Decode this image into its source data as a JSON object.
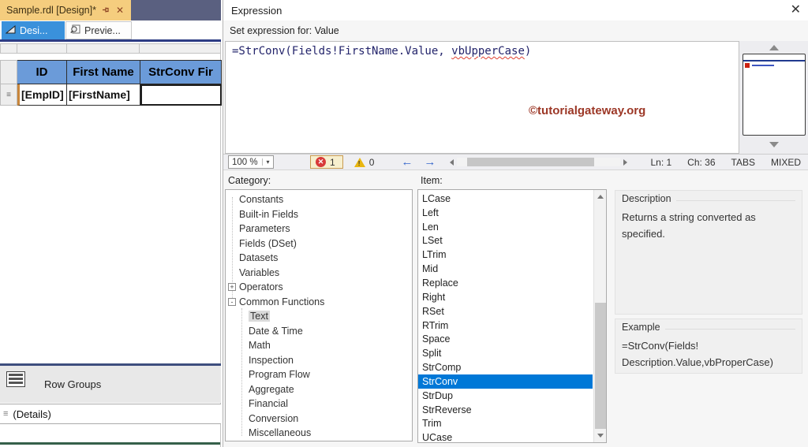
{
  "window": {
    "doc_tab_title": "Sample.rdl [Design]*",
    "close_glyph": "✕",
    "design_tab": "Desi...",
    "preview_tab": "Previe..."
  },
  "designer": {
    "table": {
      "headers": [
        "ID",
        "First Name",
        "StrConv Fir"
      ],
      "cells": [
        "[EmpID]",
        "[FirstName]",
        ""
      ],
      "row_handle_glyph": "≡"
    },
    "grouping": {
      "row_groups_label": "Row Groups",
      "details_row": "(Details)",
      "details_glyph": "≡"
    }
  },
  "dialog": {
    "title": "Expression",
    "close_glyph": "✕",
    "set_expression_label": "Set expression for: Value",
    "expression": {
      "prefix": "=StrConv(Fields!FirstName.Value, ",
      "error_token": "vbUpperCase",
      "suffix": ")"
    },
    "watermark": "©tutorialgateway.org",
    "toolbar": {
      "zoom": "100 %",
      "zoom_arrow": "▾",
      "error_count": "1",
      "warning_count": "0",
      "back_arrow": "←",
      "forward_arrow": "→",
      "ln": "Ln: 1",
      "ch": "Ch: 36",
      "tabs": "TABS",
      "mixed": "MIXED"
    },
    "category": {
      "label": "Category:",
      "items": [
        {
          "label": "Constants",
          "level": 0
        },
        {
          "label": "Built-in Fields",
          "level": 0
        },
        {
          "label": "Parameters",
          "level": 0
        },
        {
          "label": "Fields (DSet)",
          "level": 0
        },
        {
          "label": "Datasets",
          "level": 0
        },
        {
          "label": "Variables",
          "level": 0
        },
        {
          "label": "Operators",
          "level": 0,
          "expander": "+"
        },
        {
          "label": "Common Functions",
          "level": 0,
          "expander": "-"
        },
        {
          "label": "Text",
          "level": 1,
          "selected": true
        },
        {
          "label": "Date & Time",
          "level": 1
        },
        {
          "label": "Math",
          "level": 1
        },
        {
          "label": "Inspection",
          "level": 1
        },
        {
          "label": "Program Flow",
          "level": 1
        },
        {
          "label": "Aggregate",
          "level": 1
        },
        {
          "label": "Financial",
          "level": 1
        },
        {
          "label": "Conversion",
          "level": 1
        },
        {
          "label": "Miscellaneous",
          "level": 1
        }
      ]
    },
    "item": {
      "label": "Item:",
      "selected": "StrConv",
      "items": [
        "LCase",
        "Left",
        "Len",
        "LSet",
        "LTrim",
        "Mid",
        "Replace",
        "Right",
        "RSet",
        "RTrim",
        "Space",
        "Split",
        "StrComp",
        "StrConv",
        "StrDup",
        "StrReverse",
        "Trim",
        "UCase"
      ]
    },
    "description": {
      "label": "Description",
      "text": "Returns a string converted as specified."
    },
    "example": {
      "label": "Example",
      "line1": "=StrConv(Fields!",
      "line2": "Description.Value,vbProperCase)"
    }
  },
  "colors": {
    "doc_tab_gold": "#F5CD7E",
    "tab_filler_slate": "#5A6080",
    "design_tab_blue": "#3A91DB",
    "table_header_blue": "#6B9BD9",
    "selection_blue": "#0078D7",
    "watermark_red": "#9C3726",
    "expression_text": "#23246B",
    "error_red": "#D83A3A",
    "warning_yellow": "#E9B610",
    "divider_navy": "#3E4E7E",
    "bottom_green": "#35604A"
  }
}
